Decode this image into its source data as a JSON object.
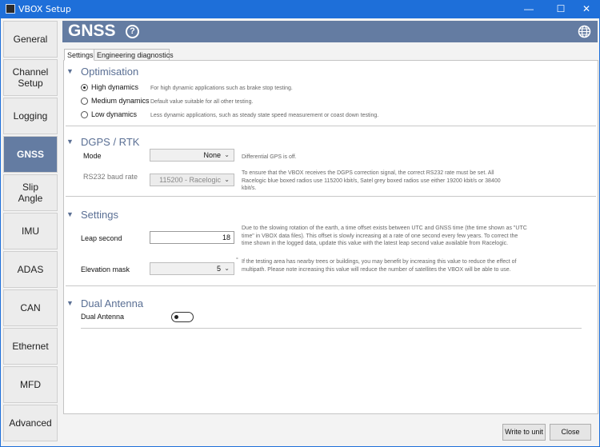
{
  "window": {
    "title": "VBOX Setup",
    "minimize": "—",
    "maximize": "☐",
    "close": "✕"
  },
  "sidebar": {
    "items": [
      {
        "label": "General"
      },
      {
        "label": "Channel\nSetup"
      },
      {
        "label": "Logging"
      },
      {
        "label": "GNSS",
        "active": true
      },
      {
        "label": "Slip\nAngle"
      },
      {
        "label": "IMU"
      },
      {
        "label": "ADAS"
      },
      {
        "label": "CAN"
      },
      {
        "label": "Ethernet"
      },
      {
        "label": "MFD"
      },
      {
        "label": "Advanced"
      }
    ]
  },
  "header": {
    "title": "GNSS",
    "help_glyph": "?"
  },
  "tabs": [
    {
      "label": "Settings",
      "active": true
    },
    {
      "label": "Engineering diagnostics"
    }
  ],
  "optimisation": {
    "title": "Optimisation",
    "options": [
      {
        "label": "High dynamics",
        "desc": "For high dynamic applications such as brake stop testing.",
        "checked": true
      },
      {
        "label": "Medium dynamics",
        "desc": "Default value suitable for all other testing."
      },
      {
        "label": "Low dynamics",
        "desc": "Less dynamic applications, such as steady state speed measurement or coast down testing."
      }
    ]
  },
  "dgps": {
    "title": "DGPS / RTK",
    "mode_label": "Mode",
    "mode_value": "None",
    "mode_desc": "Differential GPS is off.",
    "baud_label": "RS232 baud rate",
    "baud_value": "115200 - Racelogic",
    "baud_desc": "To ensure that the VBOX receives the DGPS correction signal, the correct RS232 rate must be set.  All Racelogic blue boxed radios use 115200 kbit/s, Satel grey boxed radios use either 19200 kbit/s or 38400 kbit/s."
  },
  "settings": {
    "title": "Settings",
    "leap_label": "Leap second",
    "leap_value": "18",
    "leap_desc": "Due to the slowing rotation of the earth, a time offset exists between UTC and GNSS time (the time shown as \"UTC time\" in VBOX data files).  This offset is slowly increasing at a rate of one second every few years. To correct the time shown in the logged data, update this value with the latest leap second value available from Racelogic.",
    "elev_label": "Elevation mask",
    "elev_value": "5",
    "elev_unit": "°",
    "elev_desc": "If the testing area has nearby trees or buildings, you may benefit by increasing this value to reduce the effect of multipath.  Please note increasing this value will reduce the number of satellites the VBOX will be able to use."
  },
  "dual_antenna": {
    "title": "Dual Antenna",
    "label": "Dual Antenna",
    "enabled": false
  },
  "buttons": {
    "write": "Write to unit",
    "close": "Close"
  },
  "colors": {
    "titlebar": "#1e6fd9",
    "header": "#647ca2",
    "accent_text": "#5a6f94"
  }
}
